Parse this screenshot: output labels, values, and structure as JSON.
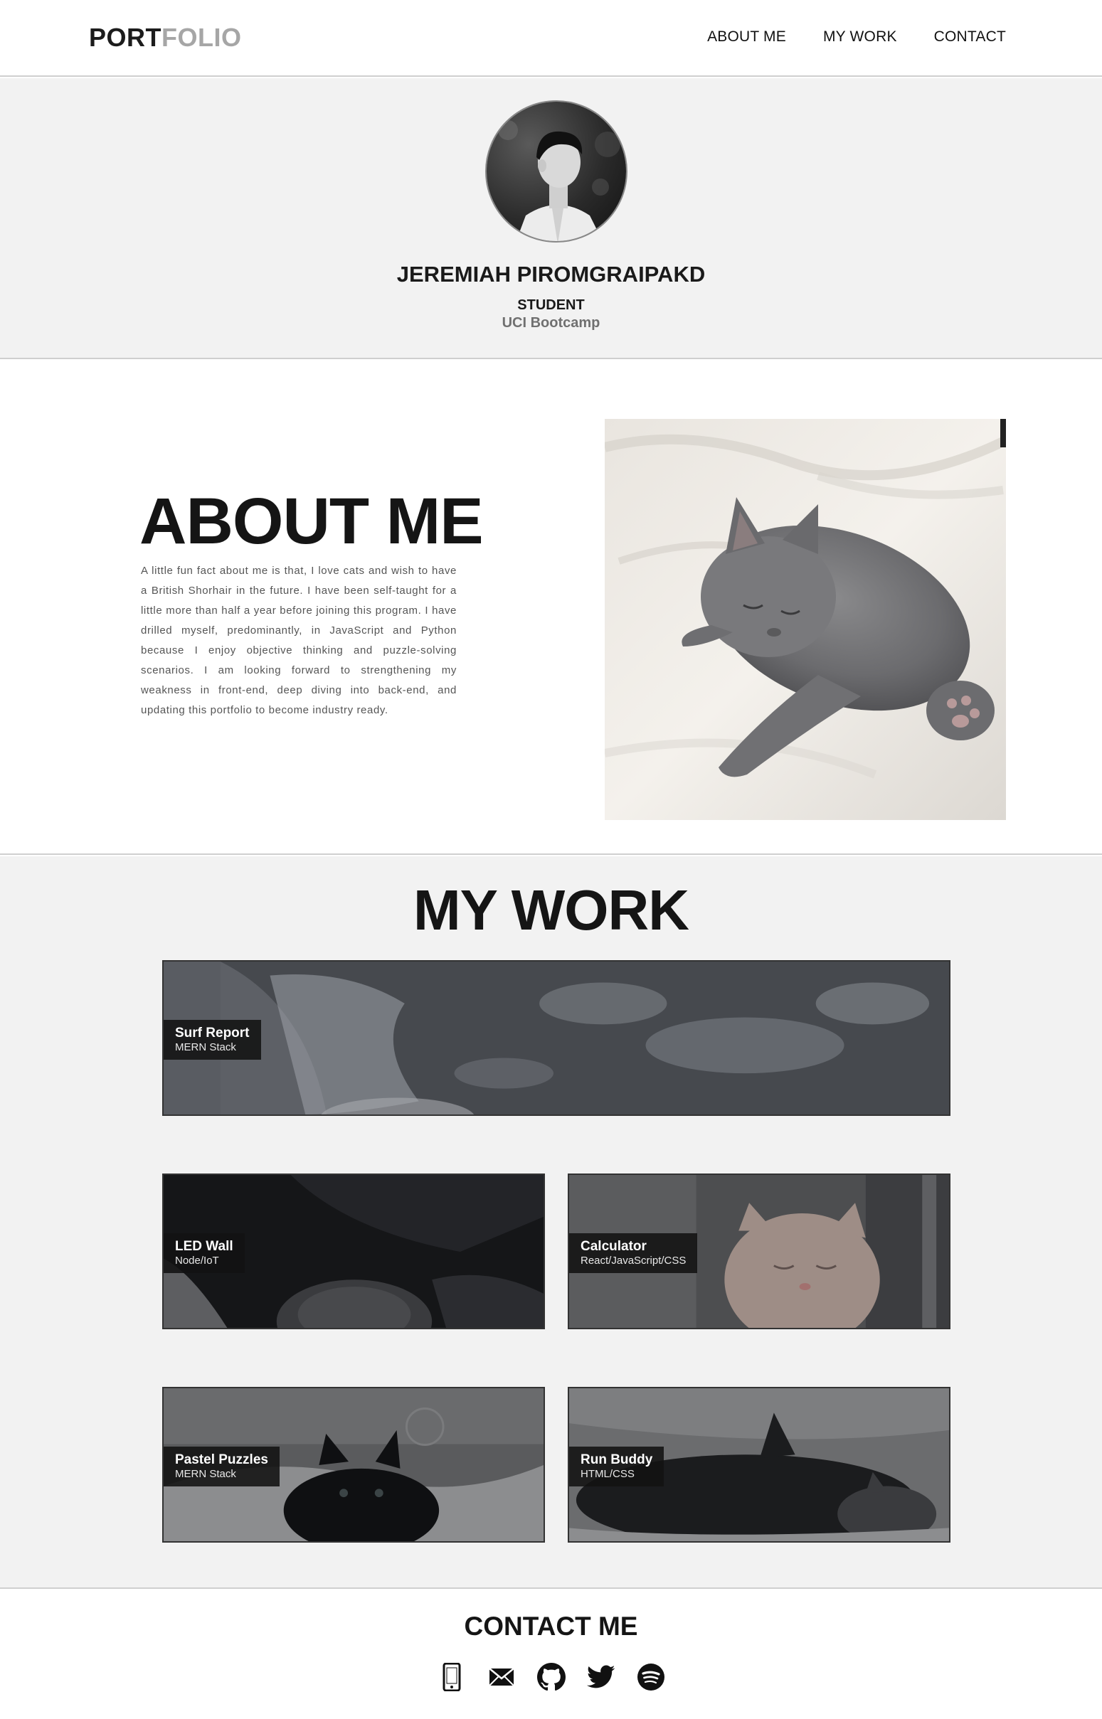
{
  "header": {
    "logo_dark": "PORT",
    "logo_light": "FOLIO",
    "nav": [
      {
        "label": "ABOUT ME",
        "icon": ""
      },
      {
        "label": "MY WORK",
        "icon": ""
      },
      {
        "label": "CONTACT",
        "icon": ""
      }
    ]
  },
  "hero": {
    "avatar_icon": "profile-photo",
    "name": "JEREMIAH PIROMGRAIPAKD",
    "role": "STUDENT",
    "organization": "UCI Bootcamp"
  },
  "about": {
    "title": "ABOUT ME",
    "text": "A little fun fact about me is that, I love cats and wish to have a British Shorhair in the future. I have been self-taught for a little more than half a year before joining this program. I have drilled myself, predominantly, in JavaScript and Python because I enjoy objective thinking and puzzle-solving scenarios. I am looking forward to strengthening my weakness in front-end, deep diving into back-end, and updating this portfolio to become industry ready.",
    "photo_icon": "sleeping-gray-kitten-photo"
  },
  "work": {
    "title": "MY WORK",
    "projects": [
      {
        "title": "Surf Report",
        "stack": "MERN Stack"
      },
      {
        "title": "LED Wall",
        "stack": "Node/IoT"
      },
      {
        "title": "Calculator",
        "stack": "React/JavaScript/CSS"
      },
      {
        "title": "Pastel Puzzles",
        "stack": "MERN Stack"
      },
      {
        "title": "Run Buddy",
        "stack": "HTML/CSS"
      }
    ]
  },
  "contact": {
    "title": "CONTACT ME",
    "icons": [
      "phone-icon",
      "email-icon",
      "github-icon",
      "twitter-icon",
      "spotify-icon"
    ]
  },
  "colors": {
    "text_dark": "#1c1c1c",
    "logo_light": "#a6a6a6",
    "section_gray": "#f2f2f2",
    "divider": "#cfcfcf",
    "tag_bg": "#121212"
  }
}
